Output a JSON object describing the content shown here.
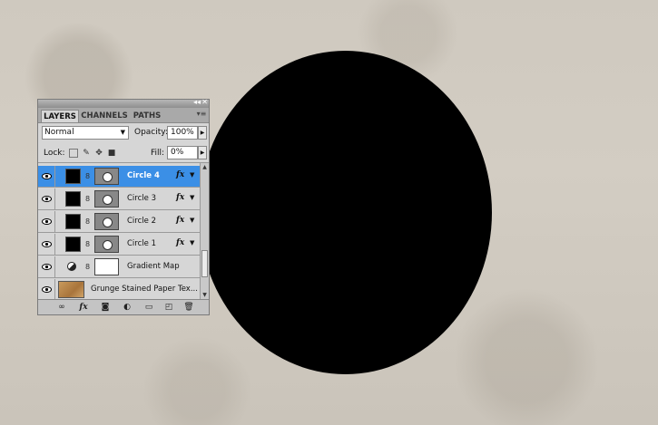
{
  "panel": {
    "tabs": [
      {
        "label": "LAYERS",
        "active": true
      },
      {
        "label": "CHANNELS",
        "active": false
      },
      {
        "label": "PATHS",
        "active": false
      }
    ],
    "blend_mode": "Normal",
    "opacity_label": "Opacity:",
    "opacity_value": "100%",
    "lock_label": "Lock:",
    "fill_label": "Fill:",
    "fill_value": "0%",
    "fx_label": "fx",
    "layers": [
      {
        "name": "Circle 4",
        "selected": true
      },
      {
        "name": "Circle 3",
        "selected": false
      },
      {
        "name": "Circle 2",
        "selected": false
      },
      {
        "name": "Circle 1",
        "selected": false
      },
      {
        "name": "Gradient Map",
        "selected": false
      },
      {
        "name": "Grunge Stained Paper Tex...",
        "selected": false
      }
    ],
    "icons": {
      "eye": "eye-icon",
      "link": "chain-link-icon",
      "adjustment": "half-circle-adjustment-icon",
      "fx": "fx-icon",
      "bottom": [
        "link-layers-icon",
        "add-style-icon",
        "add-mask-icon",
        "new-adjustment-icon",
        "new-group-icon",
        "new-layer-icon",
        "trash-icon"
      ]
    }
  },
  "colors": {
    "canvas_bg": "#cfc9bf",
    "circle": "#000000",
    "selection": "#3b8fe6",
    "panel_bg": "#d6d6d6"
  }
}
